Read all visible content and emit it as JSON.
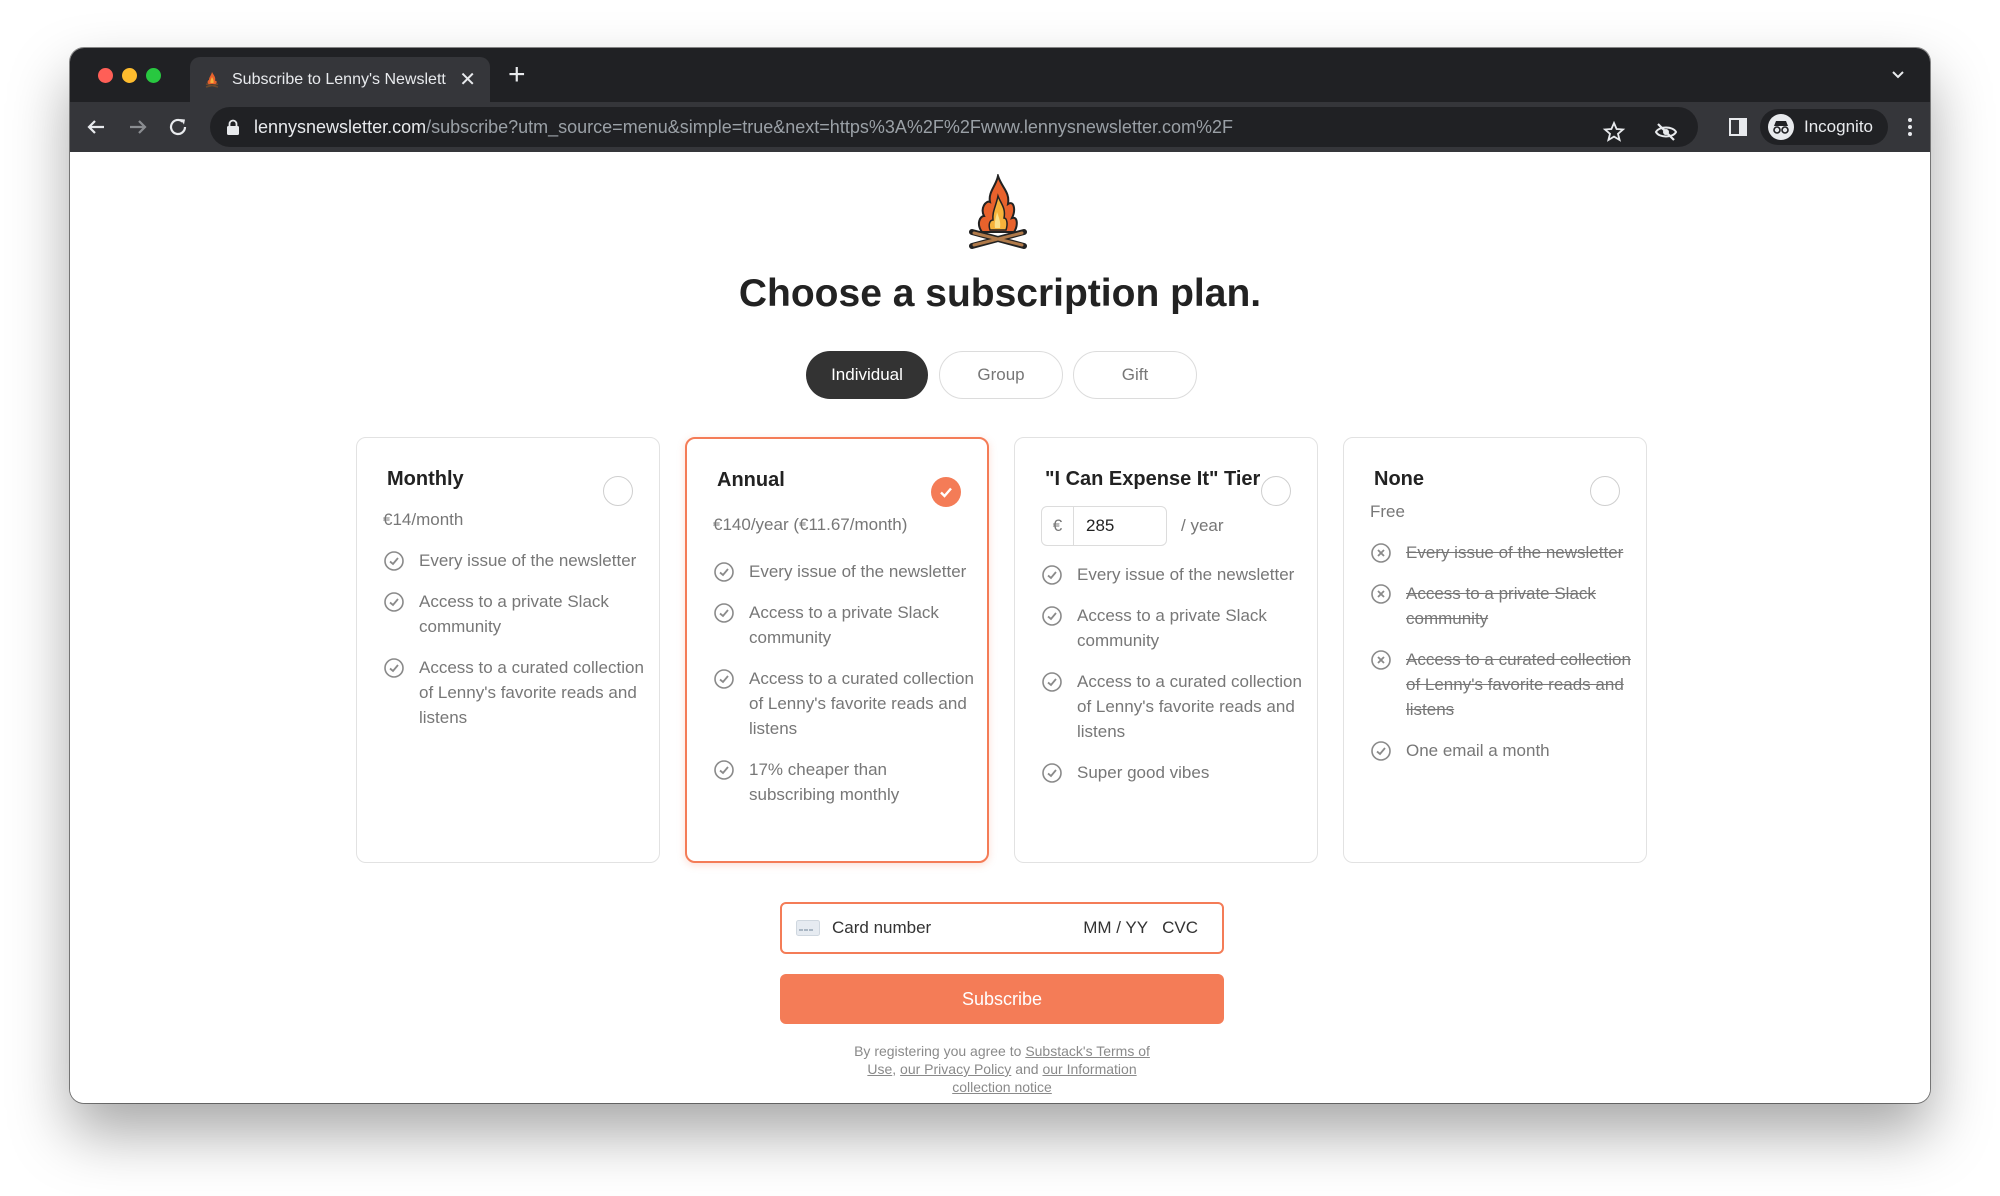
{
  "browser": {
    "tab_title": "Subscribe to Lenny's Newslett",
    "tab_close": "✕",
    "new_tab": "+",
    "url_host": "lennysnewsletter.com",
    "url_path": "/subscribe?utm_source=menu&simple=true&next=https%3A%2F%2Fwww.lennysnewsletter.com%2F",
    "profile_label": "Incognito"
  },
  "page": {
    "title": "Choose a subscription plan.",
    "segments": [
      "Individual",
      "Group",
      "Gift"
    ],
    "active_segment": "Individual"
  },
  "plans": [
    {
      "name": "Monthly",
      "price": "€14/month",
      "selected": false,
      "features": [
        {
          "text": "Every issue of the newsletter",
          "included": true
        },
        {
          "text": "Access to a private Slack community",
          "included": true
        },
        {
          "text": "Access to a curated collection of Lenny's favorite reads and listens",
          "included": true
        }
      ]
    },
    {
      "name": "Annual",
      "price": "€140/year (€11.67/month)",
      "selected": true,
      "features": [
        {
          "text": "Every issue of the newsletter",
          "included": true
        },
        {
          "text": "Access to a private Slack community",
          "included": true
        },
        {
          "text": "Access to a curated collection of Lenny's favorite reads and listens",
          "included": true
        },
        {
          "text": "17% cheaper than subscribing monthly",
          "included": true
        }
      ]
    },
    {
      "name": "\"I Can Expense It\" Tier",
      "currency_symbol": "€",
      "amount": "285",
      "period": "/ year",
      "selected": false,
      "features": [
        {
          "text": "Every issue of the newsletter",
          "included": true
        },
        {
          "text": "Access to a private Slack community",
          "included": true
        },
        {
          "text": "Access to a curated collection of Lenny's favorite reads and listens",
          "included": true
        },
        {
          "text": "Super good vibes",
          "included": true
        }
      ]
    },
    {
      "name": "None",
      "price": "Free",
      "selected": false,
      "features": [
        {
          "text": "Every issue of the newsletter",
          "included": false
        },
        {
          "text": "Access to a private Slack community",
          "included": false
        },
        {
          "text": "Access to a curated collection of Lenny's favorite reads and listens",
          "included": false
        },
        {
          "text": "One email a month",
          "included": true
        }
      ]
    }
  ],
  "payment": {
    "card_placeholder": "Card number",
    "expiry_placeholder": "MM / YY",
    "cvc_placeholder": "CVC",
    "subscribe_label": "Subscribe"
  },
  "legal": {
    "prefix": "By registering you agree to ",
    "terms": "Substack's Terms of Use",
    "sep": ", ",
    "privacy": "our Privacy Policy",
    "and": " and ",
    "notice": "our Information collection notice"
  },
  "colors": {
    "accent": "#f47c57",
    "chrome_dark": "#202124",
    "chrome_toolbar": "#35363a",
    "active_segment": "#333333"
  },
  "icons": {
    "check": "check-circle-icon",
    "excluded": "x-circle-icon",
    "lock": "lock-icon",
    "favicon": "campfire-icon"
  }
}
